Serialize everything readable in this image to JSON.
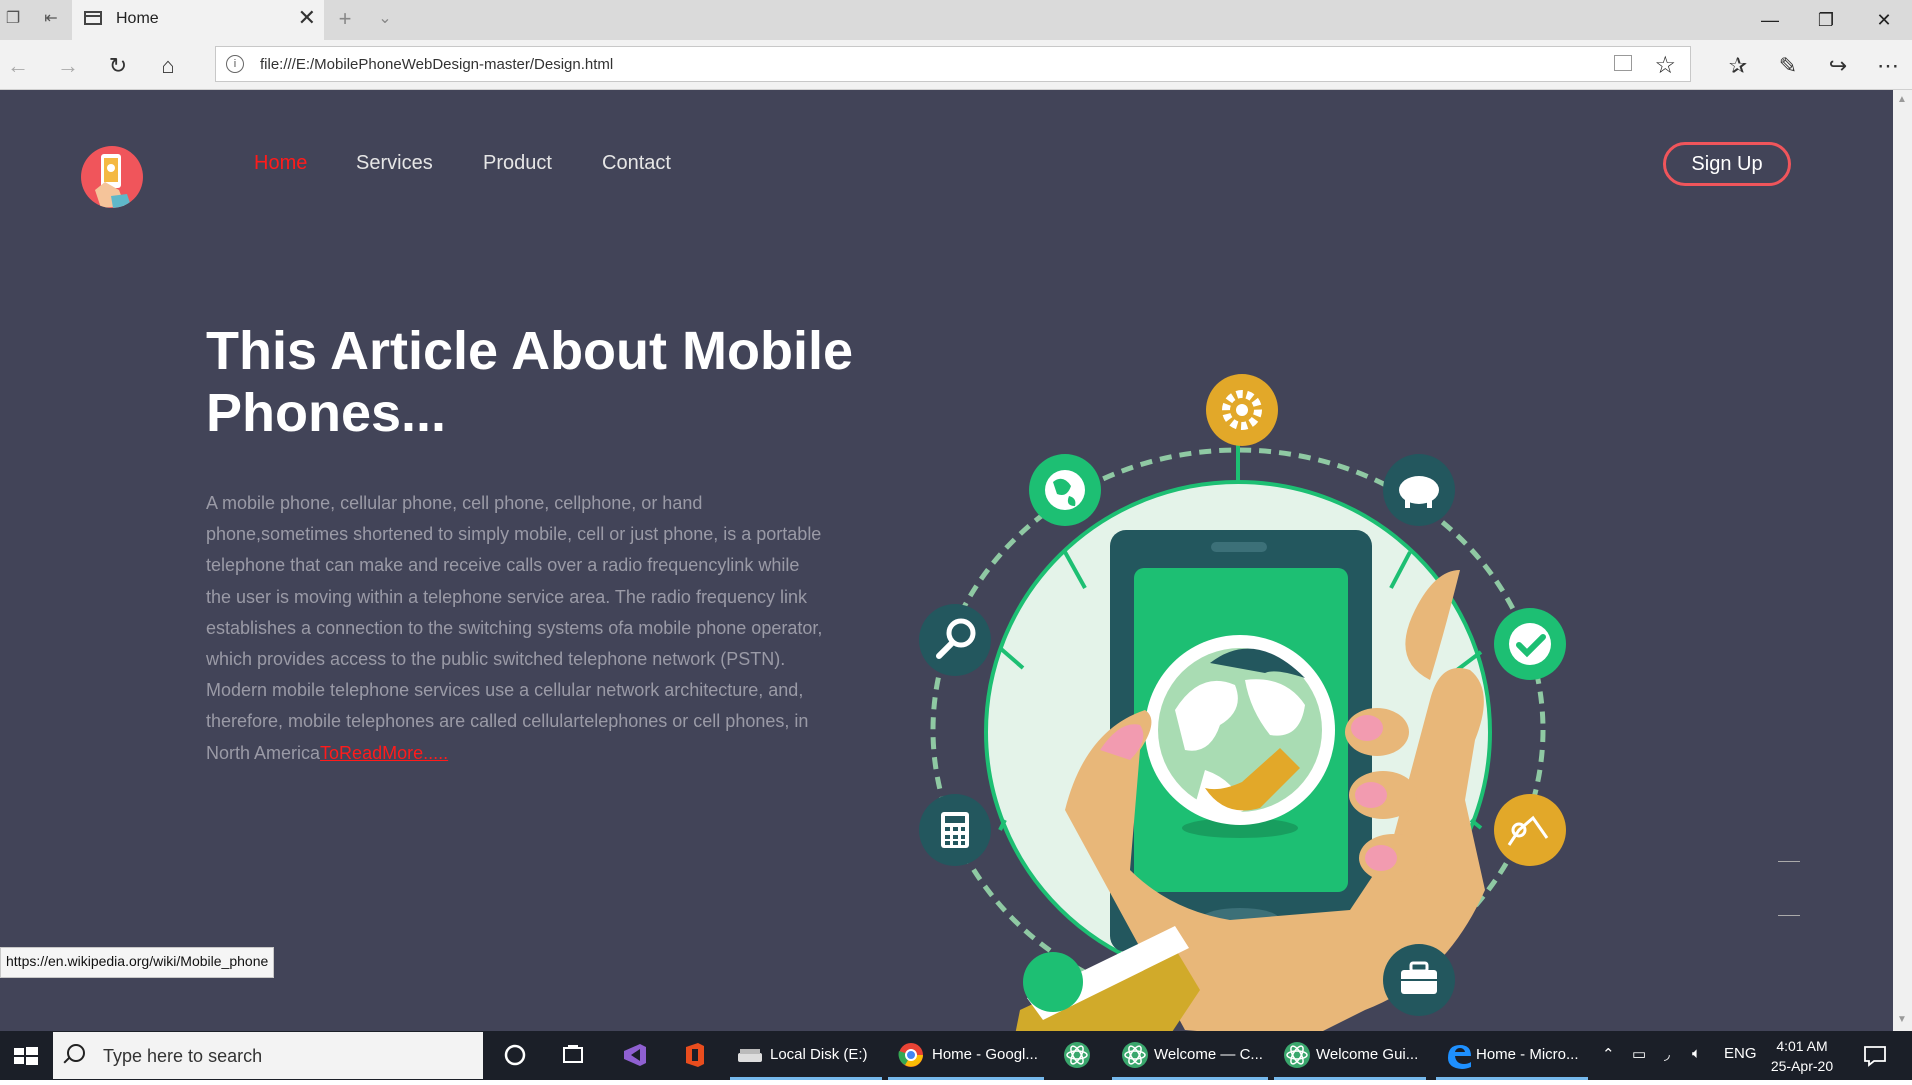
{
  "browser": {
    "tab_title": "Home",
    "address_url": "file:///E:/MobilePhoneWebDesign-master/Design.html",
    "status_url": "https://en.wikipedia.org/wiki/Mobile_phone"
  },
  "site": {
    "nav": {
      "home": "Home",
      "services": "Services",
      "product": "Product",
      "contact": "Contact",
      "signup": "Sign Up"
    },
    "headline": "This Article About Mobile Phones...",
    "body_text": "A mobile phone, cellular phone, cell phone, cellphone, or hand phone,sometimes shortened to simply mobile, cell or just phone, is a portable telephone that can make and receive calls over a radio frequencylink while the user is moving within a telephone service area. The radio frequency link establishes a connection to the switching systems ofa mobile phone operator, which provides access to the public switched telephone network (PSTN). Modern mobile telephone services use a cellular network architecture, and, therefore, mobile telephones are called cellulartelephones or cell phones, in North America",
    "read_more": "ToReadMore.....",
    "colors": {
      "page_bg": "#424458",
      "accent": "#f0555b",
      "active_link": "#ff1b1b",
      "phone_green": "#1dbf73"
    }
  },
  "taskbar": {
    "search_placeholder": "Type here to search",
    "items": [
      {
        "icon": "folder-drive-icon",
        "label": "Local Disk (E:)"
      },
      {
        "icon": "chrome-icon",
        "label": "Home - Googl..."
      },
      {
        "icon": "atom-icon",
        "label": ""
      },
      {
        "icon": "atom-icon",
        "label": "Welcome — C..."
      },
      {
        "icon": "atom-icon",
        "label": "Welcome Gui..."
      },
      {
        "icon": "edge-icon",
        "label": "Home - Micro..."
      }
    ],
    "language": "ENG",
    "time": "4:01 AM",
    "date": "25-Apr-20"
  }
}
